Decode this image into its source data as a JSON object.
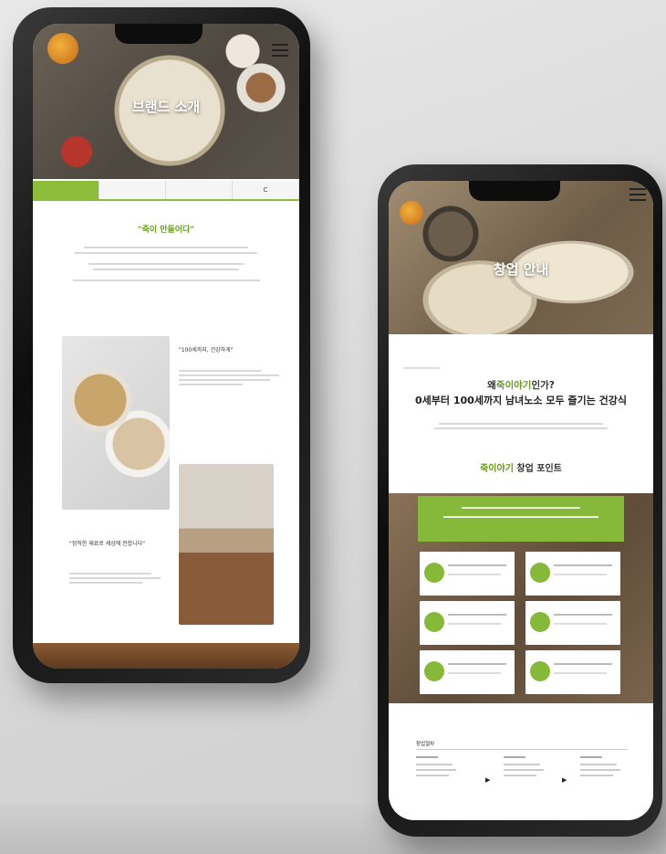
{
  "left_screen": {
    "hero_title": "브랜드 소개",
    "hero_subtitle": "",
    "tabs": [
      "",
      "",
      "",
      "C"
    ],
    "heading": "\"죽이 만들어다\"",
    "photo_caption_1": "\"100세까지, 건강하게\"",
    "photo_caption_2": "\"정직한 재료로 세상에 전합니다\""
  },
  "right_screen": {
    "hero_title": "창업 안내",
    "why_prefix": "왜",
    "why_accent": "죽이야기",
    "why_suffix": "인가?",
    "why_subtitle": "0세부터 100세까지 남녀노소 모두 즐기는 건강식",
    "points_prefix": "죽이야기",
    "points_suffix": " 창업 포인트",
    "process_title": "창업절차"
  },
  "colors": {
    "accent": "#86b83a",
    "accent_text": "#6a9b22"
  },
  "icons": [
    "hamburger-menu-icon",
    "brand-logo-icon",
    "arrow-right-icon"
  ]
}
